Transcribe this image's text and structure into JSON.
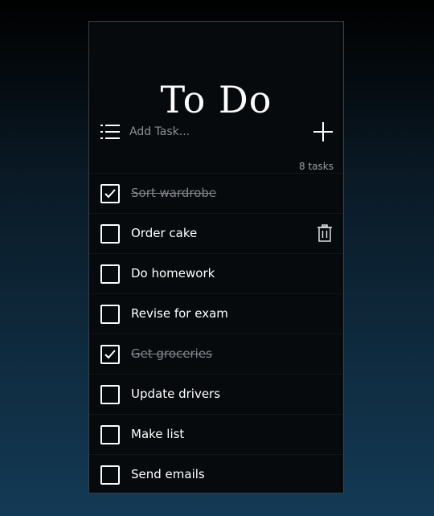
{
  "app": {
    "title": "To Do"
  },
  "add_task": {
    "placeholder": "Add Task...",
    "list_icon": "list-icon",
    "add_icon": "plus-icon"
  },
  "task_count": "8 tasks",
  "tasks": [
    {
      "label": "Sort wardrobe",
      "done": true
    },
    {
      "label": "Order cake",
      "done": false,
      "show_delete": true
    },
    {
      "label": "Do homework",
      "done": false
    },
    {
      "label": "Revise for exam",
      "done": false
    },
    {
      "label": "Get groceries",
      "done": true
    },
    {
      "label": "Update drivers",
      "done": false
    },
    {
      "label": "Make list",
      "done": false
    },
    {
      "label": "Send emails",
      "done": false
    }
  ],
  "colors": {
    "panel": "#060a0d",
    "text": "#ffffff",
    "muted": "#80868b",
    "border": "#3a3f44"
  }
}
